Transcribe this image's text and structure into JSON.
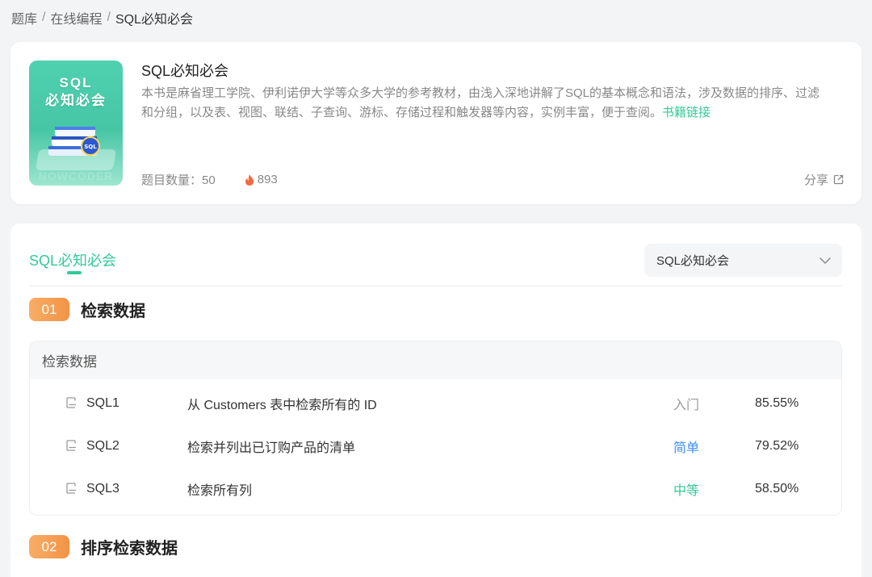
{
  "breadcrumb": {
    "items": [
      "题库",
      "在线编程"
    ],
    "current": "SQL必知必会",
    "separator": "/"
  },
  "book": {
    "cover_title_line1": "SQL",
    "cover_title_line2": "必知必会",
    "cover_watermark": "NOWCODER",
    "title": "SQL必知必会",
    "description": "本书是麻省理工学院、伊利诺伊大学等众多大学的参考教材，由浅入深地讲解了SQL的基本概念和语法，涉及数据的排序、过滤和分组，以及表、视图、联结、子查询、游标、存储过程和触发器等内容，实例丰富，便于查阅。",
    "link_text": "书籍链接",
    "question_count": "题目数量：50",
    "heat": "893",
    "share": "分享"
  },
  "main": {
    "tab": "SQL必知必会",
    "select_value": "SQL必知必会",
    "sections": [
      {
        "number": "01",
        "title": "检索数据"
      },
      {
        "number": "02",
        "title": "排序检索数据"
      }
    ],
    "group": {
      "title": "检索数据",
      "rows": [
        {
          "id": "SQL1",
          "title": "从 Customers 表中检索所有的 ID",
          "difficulty": "入门",
          "rate": "85.55%"
        },
        {
          "id": "SQL2",
          "title": "检索并列出已订购产品的清单",
          "difficulty": "简单",
          "rate": "79.52%"
        },
        {
          "id": "SQL3",
          "title": "检索所有列",
          "difficulty": "中等",
          "rate": "58.50%"
        }
      ]
    }
  },
  "colors": {
    "accent": "#32ca99",
    "badge_orange": "#f39346",
    "difficulty_intro": "#999999",
    "difficulty_easy": "#3d8ef5",
    "difficulty_medium": "#32ca99",
    "fire": "#f26a3d"
  },
  "icons": {
    "heat": "fire-icon",
    "share": "external-link-icon",
    "select": "chevron-down-icon",
    "question": "question-doc-icon"
  }
}
